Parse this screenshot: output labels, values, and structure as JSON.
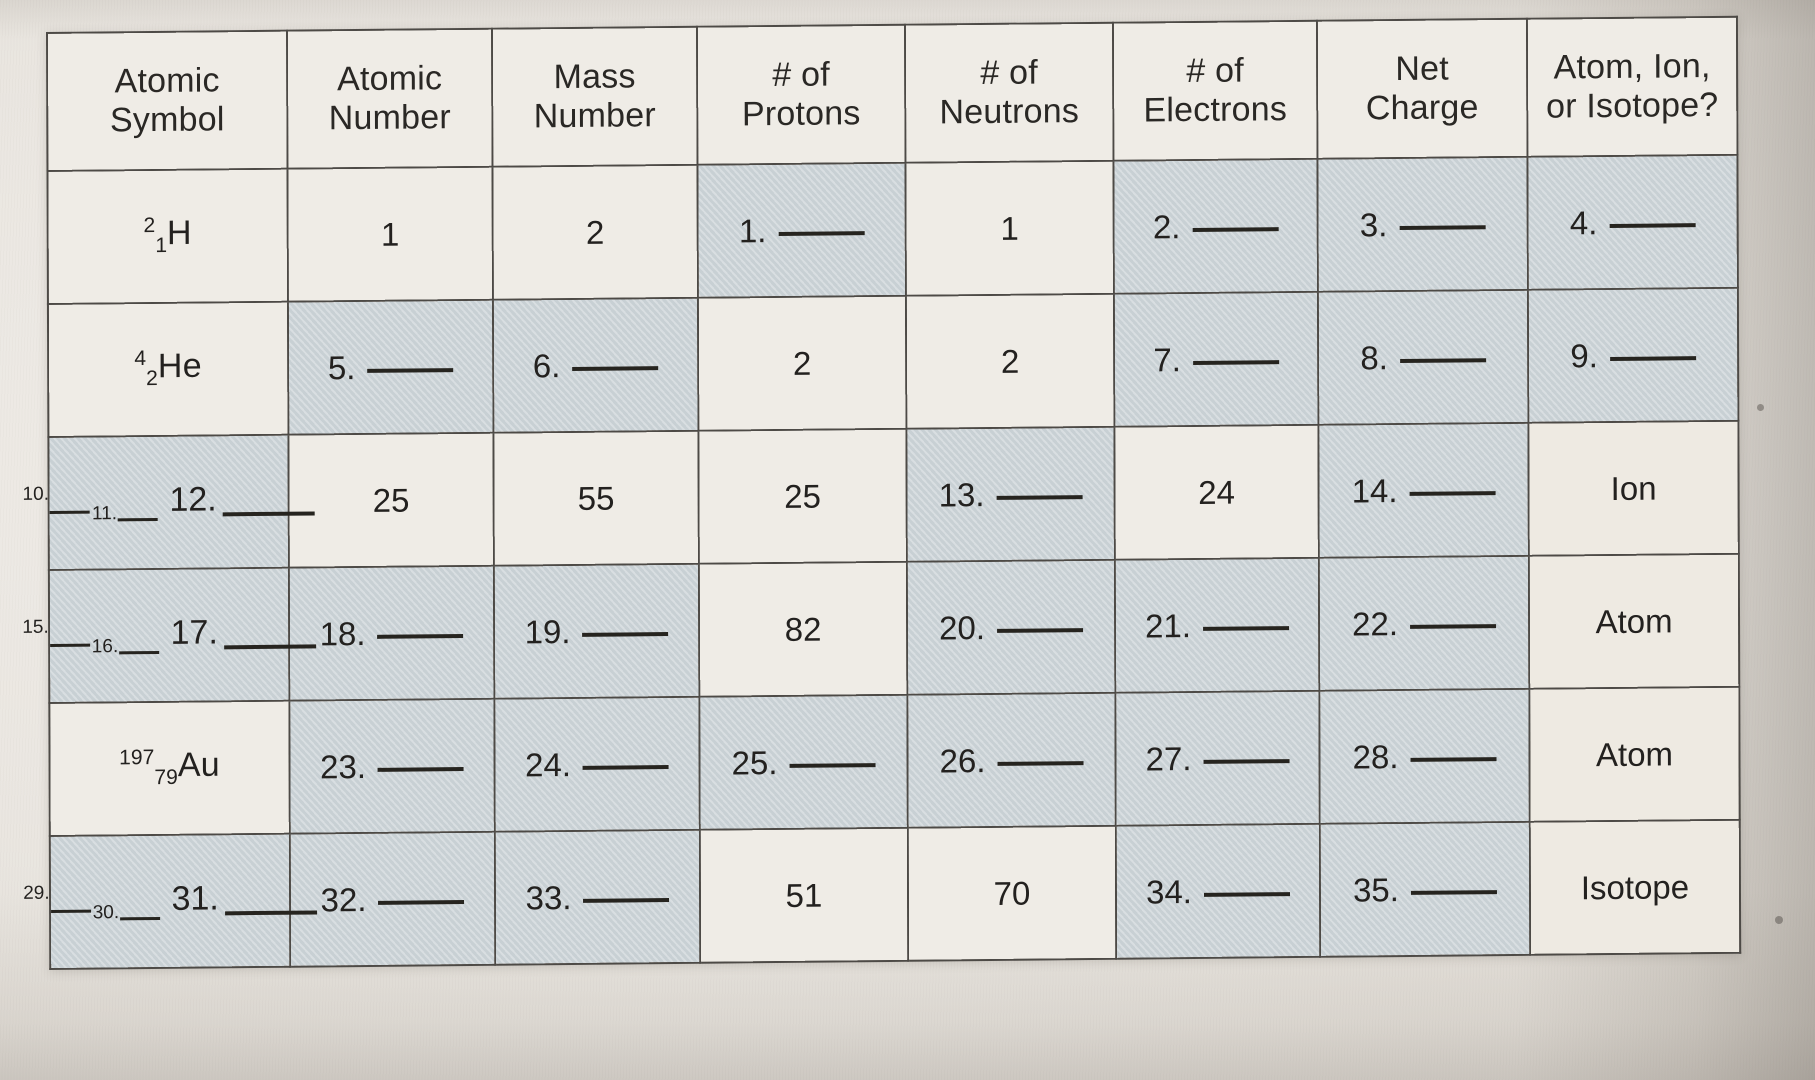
{
  "document": {
    "kind": "chemistry-worksheet-table",
    "columns": [
      "Atomic\nSymbol",
      "Atomic\nNumber",
      "Mass\nNumber",
      "# of\nProtons",
      "# of\nNeutrons",
      "# of\nElectrons",
      "Net\nCharge",
      "Atom, Ion,\nor Isotope?"
    ],
    "rows": [
      {
        "symbol": {
          "type": "isotope",
          "mass": "2",
          "atomic": "1",
          "element": "H"
        },
        "atomic_number": {
          "type": "value",
          "text": "1"
        },
        "mass_number": {
          "type": "value",
          "text": "2"
        },
        "protons": {
          "type": "blank",
          "number": "1."
        },
        "neutrons": {
          "type": "value",
          "text": "1"
        },
        "electrons": {
          "type": "blank",
          "number": "2."
        },
        "net_charge": {
          "type": "blank",
          "number": "3."
        },
        "classification": {
          "type": "blank",
          "number": "4."
        }
      },
      {
        "symbol": {
          "type": "isotope",
          "mass": "4",
          "atomic": "2",
          "element": "He"
        },
        "atomic_number": {
          "type": "blank",
          "number": "5."
        },
        "mass_number": {
          "type": "blank",
          "number": "6."
        },
        "protons": {
          "type": "value",
          "text": "2"
        },
        "neutrons": {
          "type": "value",
          "text": "2"
        },
        "electrons": {
          "type": "blank",
          "number": "7."
        },
        "net_charge": {
          "type": "blank",
          "number": "8."
        },
        "classification": {
          "type": "blank",
          "number": "9."
        }
      },
      {
        "symbol": {
          "type": "isotope_blank",
          "mass": "10.",
          "atomic": "11.",
          "element": "12."
        },
        "atomic_number": {
          "type": "value",
          "text": "25"
        },
        "mass_number": {
          "type": "value",
          "text": "55"
        },
        "protons": {
          "type": "value",
          "text": "25"
        },
        "neutrons": {
          "type": "blank",
          "number": "13."
        },
        "electrons": {
          "type": "value",
          "text": "24"
        },
        "net_charge": {
          "type": "blank",
          "number": "14."
        },
        "classification": {
          "type": "value",
          "text": "Ion"
        }
      },
      {
        "symbol": {
          "type": "isotope_blank",
          "mass": "15.",
          "atomic": "16.",
          "element": "17."
        },
        "atomic_number": {
          "type": "blank",
          "number": "18."
        },
        "mass_number": {
          "type": "blank",
          "number": "19."
        },
        "protons": {
          "type": "value",
          "text": "82"
        },
        "neutrons": {
          "type": "blank",
          "number": "20."
        },
        "electrons": {
          "type": "blank",
          "number": "21."
        },
        "net_charge": {
          "type": "blank",
          "number": "22."
        },
        "classification": {
          "type": "value",
          "text": "Atom"
        }
      },
      {
        "symbol": {
          "type": "isotope",
          "mass": "197",
          "atomic": "79",
          "element": "Au"
        },
        "atomic_number": {
          "type": "blank",
          "number": "23."
        },
        "mass_number": {
          "type": "blank",
          "number": "24."
        },
        "protons": {
          "type": "blank",
          "number": "25."
        },
        "neutrons": {
          "type": "blank",
          "number": "26."
        },
        "electrons": {
          "type": "blank",
          "number": "27."
        },
        "net_charge": {
          "type": "blank",
          "number": "28."
        },
        "classification": {
          "type": "value",
          "text": "Atom"
        }
      },
      {
        "symbol": {
          "type": "isotope_blank",
          "mass": "29.",
          "atomic": "30.",
          "element": "31."
        },
        "atomic_number": {
          "type": "blank",
          "number": "32."
        },
        "mass_number": {
          "type": "blank",
          "number": "33."
        },
        "protons": {
          "type": "value",
          "text": "51"
        },
        "neutrons": {
          "type": "value",
          "text": "70"
        },
        "electrons": {
          "type": "blank",
          "number": "34."
        },
        "net_charge": {
          "type": "blank",
          "number": "35."
        },
        "classification": {
          "type": "value",
          "text": "Isotope"
        }
      }
    ],
    "cell_shading": [
      [
        "plain",
        "plain",
        "plain",
        "shade",
        "plain",
        "shade",
        "shade",
        "shade"
      ],
      [
        "plain",
        "shade",
        "shade",
        "plain",
        "plain",
        "shade",
        "shade",
        "shade"
      ],
      [
        "shade",
        "plain",
        "plain",
        "plain",
        "shade",
        "plain",
        "shade",
        "warm"
      ],
      [
        "shade",
        "shade",
        "shade",
        "plain",
        "shade",
        "shade",
        "shade",
        "warm"
      ],
      [
        "plain",
        "shade",
        "shade",
        "shade",
        "shade",
        "shade",
        "shade",
        "warm"
      ],
      [
        "shade",
        "shade",
        "shade",
        "plain",
        "plain",
        "shade",
        "shade",
        "warm"
      ]
    ],
    "colors": {
      "paper": "#efece6",
      "shaded_cell": "#c8d0d4",
      "warm_cell": "#eeeae2",
      "rule": "#4d4a46",
      "ink": "#23211f"
    }
  }
}
